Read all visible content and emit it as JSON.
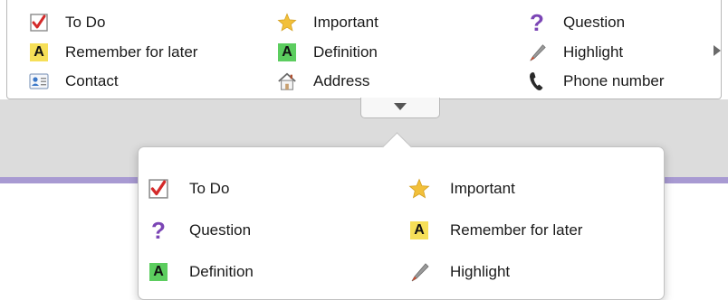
{
  "colors": {
    "check": "#d42a2a",
    "star": "#f2c03a",
    "question": "#7b45b5",
    "remember_bg": "#f6df58",
    "definition_bg": "#5ccd5f",
    "highlight": "#8a8a8a",
    "band": "#dcdcdc",
    "accent_line": "#a89ad2"
  },
  "gallery": {
    "items": [
      {
        "label": "To Do",
        "icon": "checkbox-checked-icon"
      },
      {
        "label": "Important",
        "icon": "star-icon"
      },
      {
        "label": "Question",
        "icon": "question-mark-icon"
      },
      {
        "label": "Remember for later",
        "icon": "letter-a-yellow-icon",
        "icon_text": "A"
      },
      {
        "label": "Definition",
        "icon": "letter-a-green-icon",
        "icon_text": "A"
      },
      {
        "label": "Highlight",
        "icon": "highlighter-pen-icon"
      },
      {
        "label": "Contact",
        "icon": "contact-card-icon"
      },
      {
        "label": "Address",
        "icon": "house-icon"
      },
      {
        "label": "Phone number",
        "icon": "phone-icon"
      }
    ],
    "more_icon": "triangle-right-icon",
    "expand_icon": "triangle-down-icon"
  },
  "dropdown": {
    "items": [
      {
        "label": "To Do",
        "icon": "checkbox-checked-icon"
      },
      {
        "label": "Important",
        "icon": "star-icon"
      },
      {
        "label": "Question",
        "icon": "question-mark-icon",
        "icon_text": "?"
      },
      {
        "label": "Remember for later",
        "icon": "letter-a-yellow-icon",
        "icon_text": "A"
      },
      {
        "label": "Definition",
        "icon": "letter-a-green-icon",
        "icon_text": "A"
      },
      {
        "label": "Highlight",
        "icon": "highlighter-pen-icon"
      }
    ]
  }
}
